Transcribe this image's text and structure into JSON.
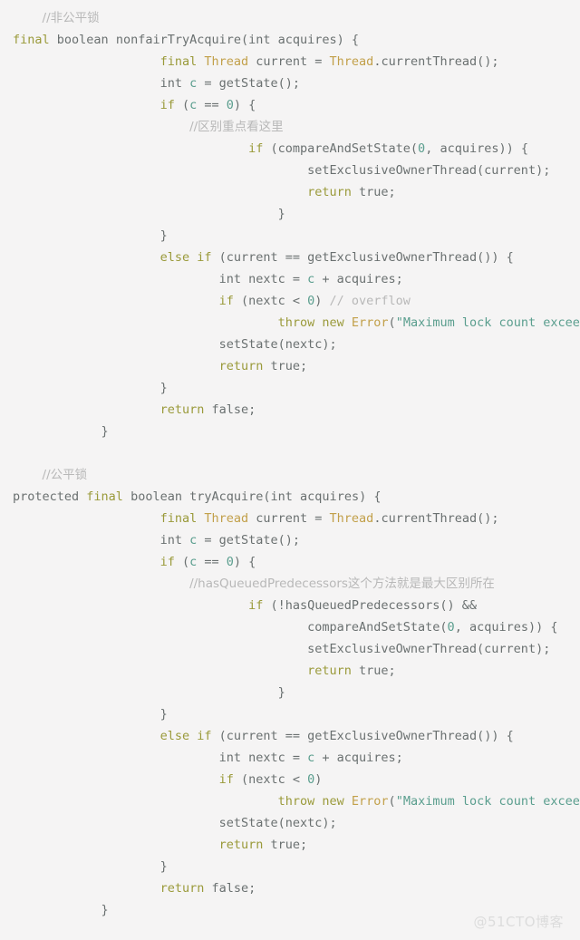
{
  "theme": {
    "background": "#f5f4f4",
    "keyword_color": "#9a9a3a",
    "type_color": "#6a7070",
    "class_color": "#c2a04a",
    "literal_color": "#5a9e8e",
    "comment_color": "#b8b8b8",
    "watermark_color": "#dcdcdc"
  },
  "watermark": {
    "text": "@51CTO博客"
  },
  "code": {
    "language": "java",
    "blocks": [
      {
        "name": "nonfair-lock-block",
        "lines": [
          {
            "indent": 1,
            "tokens": [
              {
                "t": "cmt",
                "v": "//非公平锁"
              }
            ]
          },
          {
            "indent": 0,
            "tokens": [
              {
                "t": "kw",
                "v": "final"
              },
              {
                "t": "pln",
                "v": " "
              },
              {
                "t": "type",
                "v": "boolean"
              },
              {
                "t": "pln",
                "v": " nonfairTryAcquire("
              },
              {
                "t": "type",
                "v": "int"
              },
              {
                "t": "pln",
                "v": " acquires) {"
              }
            ]
          },
          {
            "indent": 5,
            "tokens": [
              {
                "t": "kw",
                "v": "final"
              },
              {
                "t": "pln",
                "v": " "
              },
              {
                "t": "cls",
                "v": "Thread"
              },
              {
                "t": "pln",
                "v": " current = "
              },
              {
                "t": "cls",
                "v": "Thread"
              },
              {
                "t": "pln",
                "v": ".currentThread();"
              }
            ]
          },
          {
            "indent": 5,
            "tokens": [
              {
                "t": "type",
                "v": "int"
              },
              {
                "t": "pln",
                "v": " "
              },
              {
                "t": "lit",
                "v": "c"
              },
              {
                "t": "pln",
                "v": " = getState();"
              }
            ]
          },
          {
            "indent": 5,
            "tokens": [
              {
                "t": "kw",
                "v": "if"
              },
              {
                "t": "pln",
                "v": " ("
              },
              {
                "t": "lit",
                "v": "c"
              },
              {
                "t": "pln",
                "v": " == "
              },
              {
                "t": "lit",
                "v": "0"
              },
              {
                "t": "pln",
                "v": ") {"
              }
            ]
          },
          {
            "indent": 6,
            "tokens": [
              {
                "t": "cmt",
                "v": "//区别重点看这里"
              }
            ]
          },
          {
            "indent": 8,
            "tokens": [
              {
                "t": "kw",
                "v": "if"
              },
              {
                "t": "pln",
                "v": " (compareAndSetState("
              },
              {
                "t": "lit",
                "v": "0"
              },
              {
                "t": "pln",
                "v": ", acquires)) {"
              }
            ]
          },
          {
            "indent": 10,
            "tokens": [
              {
                "t": "pln",
                "v": "setExclusiveOwnerThread(current);"
              }
            ]
          },
          {
            "indent": 10,
            "tokens": [
              {
                "t": "kw",
                "v": "return"
              },
              {
                "t": "pln",
                "v": " "
              },
              {
                "t": "type",
                "v": "true"
              },
              {
                "t": "pln",
                "v": ";"
              }
            ]
          },
          {
            "indent": 9,
            "tokens": [
              {
                "t": "pln",
                "v": "}"
              }
            ]
          },
          {
            "indent": 5,
            "tokens": [
              {
                "t": "pln",
                "v": "}"
              }
            ]
          },
          {
            "indent": 5,
            "tokens": [
              {
                "t": "kw",
                "v": "else if"
              },
              {
                "t": "pln",
                "v": " (current == getExclusiveOwnerThread()) {"
              }
            ]
          },
          {
            "indent": 7,
            "tokens": [
              {
                "t": "type",
                "v": "int"
              },
              {
                "t": "pln",
                "v": " nextc = "
              },
              {
                "t": "lit",
                "v": "c"
              },
              {
                "t": "pln",
                "v": " + acquires;"
              }
            ]
          },
          {
            "indent": 7,
            "tokens": [
              {
                "t": "kw",
                "v": "if"
              },
              {
                "t": "pln",
                "v": " (nextc < "
              },
              {
                "t": "lit",
                "v": "0"
              },
              {
                "t": "pln",
                "v": ") "
              },
              {
                "t": "cmt",
                "v": "// overflow"
              }
            ]
          },
          {
            "indent": 9,
            "tokens": [
              {
                "t": "kw",
                "v": "throw new"
              },
              {
                "t": "pln",
                "v": " "
              },
              {
                "t": "cls",
                "v": "Error"
              },
              {
                "t": "pln",
                "v": "("
              },
              {
                "t": "lit",
                "v": "\"Maximum lock count exceeded\""
              },
              {
                "t": "pln",
                "v": ");"
              }
            ]
          },
          {
            "indent": 7,
            "tokens": [
              {
                "t": "pln",
                "v": "setState(nextc);"
              }
            ]
          },
          {
            "indent": 7,
            "tokens": [
              {
                "t": "kw",
                "v": "return"
              },
              {
                "t": "pln",
                "v": " "
              },
              {
                "t": "type",
                "v": "true"
              },
              {
                "t": "pln",
                "v": ";"
              }
            ]
          },
          {
            "indent": 5,
            "tokens": [
              {
                "t": "pln",
                "v": "}"
              }
            ]
          },
          {
            "indent": 5,
            "tokens": [
              {
                "t": "kw",
                "v": "return"
              },
              {
                "t": "pln",
                "v": " "
              },
              {
                "t": "type",
                "v": "false"
              },
              {
                "t": "pln",
                "v": ";"
              }
            ]
          },
          {
            "indent": 3,
            "tokens": [
              {
                "t": "pln",
                "v": "}"
              }
            ]
          },
          {
            "indent": 0,
            "tokens": []
          },
          {
            "indent": 1,
            "tokens": [
              {
                "t": "cmt",
                "v": "//公平锁"
              }
            ]
          },
          {
            "indent": 0,
            "tokens": [
              {
                "t": "type",
                "v": "protected"
              },
              {
                "t": "pln",
                "v": " "
              },
              {
                "t": "kw",
                "v": "final"
              },
              {
                "t": "pln",
                "v": " "
              },
              {
                "t": "type",
                "v": "boolean"
              },
              {
                "t": "pln",
                "v": " tryAcquire("
              },
              {
                "t": "type",
                "v": "int"
              },
              {
                "t": "pln",
                "v": " acquires) {"
              }
            ]
          },
          {
            "indent": 5,
            "tokens": [
              {
                "t": "kw",
                "v": "final"
              },
              {
                "t": "pln",
                "v": " "
              },
              {
                "t": "cls",
                "v": "Thread"
              },
              {
                "t": "pln",
                "v": " current = "
              },
              {
                "t": "cls",
                "v": "Thread"
              },
              {
                "t": "pln",
                "v": ".currentThread();"
              }
            ]
          },
          {
            "indent": 5,
            "tokens": [
              {
                "t": "type",
                "v": "int"
              },
              {
                "t": "pln",
                "v": " "
              },
              {
                "t": "lit",
                "v": "c"
              },
              {
                "t": "pln",
                "v": " = getState();"
              }
            ]
          },
          {
            "indent": 5,
            "tokens": [
              {
                "t": "kw",
                "v": "if"
              },
              {
                "t": "pln",
                "v": " ("
              },
              {
                "t": "lit",
                "v": "c"
              },
              {
                "t": "pln",
                "v": " == "
              },
              {
                "t": "lit",
                "v": "0"
              },
              {
                "t": "pln",
                "v": ") {"
              }
            ]
          },
          {
            "indent": 6,
            "tokens": [
              {
                "t": "cmt",
                "v": "//hasQueuedPredecessors这个方法就是最大区别所在"
              }
            ]
          },
          {
            "indent": 8,
            "tokens": [
              {
                "t": "kw",
                "v": "if"
              },
              {
                "t": "pln",
                "v": " (!hasQueuedPredecessors() &&"
              }
            ]
          },
          {
            "indent": 10,
            "tokens": [
              {
                "t": "pln",
                "v": "compareAndSetState("
              },
              {
                "t": "lit",
                "v": "0"
              },
              {
                "t": "pln",
                "v": ", acquires)) {"
              }
            ]
          },
          {
            "indent": 10,
            "tokens": [
              {
                "t": "pln",
                "v": "setExclusiveOwnerThread(current);"
              }
            ]
          },
          {
            "indent": 10,
            "tokens": [
              {
                "t": "kw",
                "v": "return"
              },
              {
                "t": "pln",
                "v": " "
              },
              {
                "t": "type",
                "v": "true"
              },
              {
                "t": "pln",
                "v": ";"
              }
            ]
          },
          {
            "indent": 9,
            "tokens": [
              {
                "t": "pln",
                "v": "}"
              }
            ]
          },
          {
            "indent": 5,
            "tokens": [
              {
                "t": "pln",
                "v": "}"
              }
            ]
          },
          {
            "indent": 5,
            "tokens": [
              {
                "t": "kw",
                "v": "else if"
              },
              {
                "t": "pln",
                "v": " (current == getExclusiveOwnerThread()) {"
              }
            ]
          },
          {
            "indent": 7,
            "tokens": [
              {
                "t": "type",
                "v": "int"
              },
              {
                "t": "pln",
                "v": " nextc = "
              },
              {
                "t": "lit",
                "v": "c"
              },
              {
                "t": "pln",
                "v": " + acquires;"
              }
            ]
          },
          {
            "indent": 7,
            "tokens": [
              {
                "t": "kw",
                "v": "if"
              },
              {
                "t": "pln",
                "v": " (nextc < "
              },
              {
                "t": "lit",
                "v": "0"
              },
              {
                "t": "pln",
                "v": ")"
              }
            ]
          },
          {
            "indent": 9,
            "tokens": [
              {
                "t": "kw",
                "v": "throw new"
              },
              {
                "t": "pln",
                "v": " "
              },
              {
                "t": "cls",
                "v": "Error"
              },
              {
                "t": "pln",
                "v": "("
              },
              {
                "t": "lit",
                "v": "\"Maximum lock count exceeded\""
              },
              {
                "t": "pln",
                "v": ");"
              }
            ]
          },
          {
            "indent": 7,
            "tokens": [
              {
                "t": "pln",
                "v": "setState(nextc);"
              }
            ]
          },
          {
            "indent": 7,
            "tokens": [
              {
                "t": "kw",
                "v": "return"
              },
              {
                "t": "pln",
                "v": " "
              },
              {
                "t": "type",
                "v": "true"
              },
              {
                "t": "pln",
                "v": ";"
              }
            ]
          },
          {
            "indent": 5,
            "tokens": [
              {
                "t": "pln",
                "v": "}"
              }
            ]
          },
          {
            "indent": 5,
            "tokens": [
              {
                "t": "kw",
                "v": "return"
              },
              {
                "t": "pln",
                "v": " "
              },
              {
                "t": "type",
                "v": "false"
              },
              {
                "t": "pln",
                "v": ";"
              }
            ]
          },
          {
            "indent": 3,
            "tokens": [
              {
                "t": "pln",
                "v": "}"
              }
            ]
          }
        ]
      }
    ]
  }
}
